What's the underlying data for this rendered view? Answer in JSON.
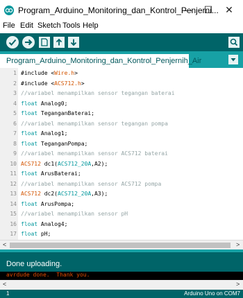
{
  "window": {
    "title": "Program_Arduino_Monitoring_dan_Kontrol_Penjerni...",
    "minimize": "—",
    "maximize": "☐",
    "close": "✕"
  },
  "menu": [
    "File",
    "Edit",
    "Sketch",
    "Tools",
    "Help"
  ],
  "toolbar": {
    "verify": "check-icon",
    "upload": "arrow-right-icon",
    "new": "new-file-icon",
    "open": "arrow-up-icon",
    "save": "arrow-down-icon",
    "serial_monitor": "magnifier-icon"
  },
  "tab": {
    "label": "Program_Arduino_Monitoring_dan_Kontrol_Penjernih_Air"
  },
  "code_lines": [
    [
      {
        "t": "#include <",
        "c": "plain"
      },
      {
        "t": "Wire.h",
        "c": "orange"
      },
      {
        "t": ">",
        "c": "plain"
      }
    ],
    [
      {
        "t": "#include <",
        "c": "plain"
      },
      {
        "t": "ACS712.h",
        "c": "orange"
      },
      {
        "t": ">",
        "c": "plain"
      }
    ],
    [
      {
        "t": "//variabel menampilkan sensor tegangan baterai",
        "c": "comment"
      }
    ],
    [
      {
        "t": "float",
        "c": "teal"
      },
      {
        "t": " Analog0;",
        "c": "plain"
      }
    ],
    [
      {
        "t": "float",
        "c": "teal"
      },
      {
        "t": " TeganganBaterai;",
        "c": "plain"
      }
    ],
    [
      {
        "t": "//variabel menampilkan sensor tegangan pompa",
        "c": "comment"
      }
    ],
    [
      {
        "t": "float",
        "c": "teal"
      },
      {
        "t": " Analog1;",
        "c": "plain"
      }
    ],
    [
      {
        "t": "float",
        "c": "teal"
      },
      {
        "t": " TeganganPompa;",
        "c": "plain"
      }
    ],
    [
      {
        "t": "//variabel menampilkan sensor ACS712 baterai",
        "c": "comment"
      }
    ],
    [
      {
        "t": "ACS712",
        "c": "orange"
      },
      {
        "t": " dc1(",
        "c": "plain"
      },
      {
        "t": "ACS712_20A",
        "c": "teal"
      },
      {
        "t": ",A2);",
        "c": "plain"
      }
    ],
    [
      {
        "t": "float",
        "c": "teal"
      },
      {
        "t": " ArusBaterai;",
        "c": "plain"
      }
    ],
    [
      {
        "t": "//variabel menampilkan sensor ACS712 pompa",
        "c": "comment"
      }
    ],
    [
      {
        "t": "ACS712",
        "c": "orange"
      },
      {
        "t": " dc2(",
        "c": "plain"
      },
      {
        "t": "ACS712_20A",
        "c": "teal"
      },
      {
        "t": ",A3);",
        "c": "plain"
      }
    ],
    [
      {
        "t": "float",
        "c": "teal"
      },
      {
        "t": " ArusPompa;",
        "c": "plain"
      }
    ],
    [
      {
        "t": "//variabel menampilkan sensor pH",
        "c": "comment"
      }
    ],
    [
      {
        "t": "float",
        "c": "teal"
      },
      {
        "t": " Analog4;",
        "c": "plain"
      }
    ],
    [
      {
        "t": "float",
        "c": "teal"
      },
      {
        "t": " pH;",
        "c": "plain"
      }
    ]
  ],
  "status": {
    "message": "Done uploading."
  },
  "console": {
    "text": "avrdude done.  Thank you."
  },
  "footer": {
    "line": "1",
    "board": "Arduino Uno on COM7"
  },
  "colors": {
    "toolbar": "#006468",
    "accent": "#17a1a5",
    "console_text": "#e34c00"
  }
}
